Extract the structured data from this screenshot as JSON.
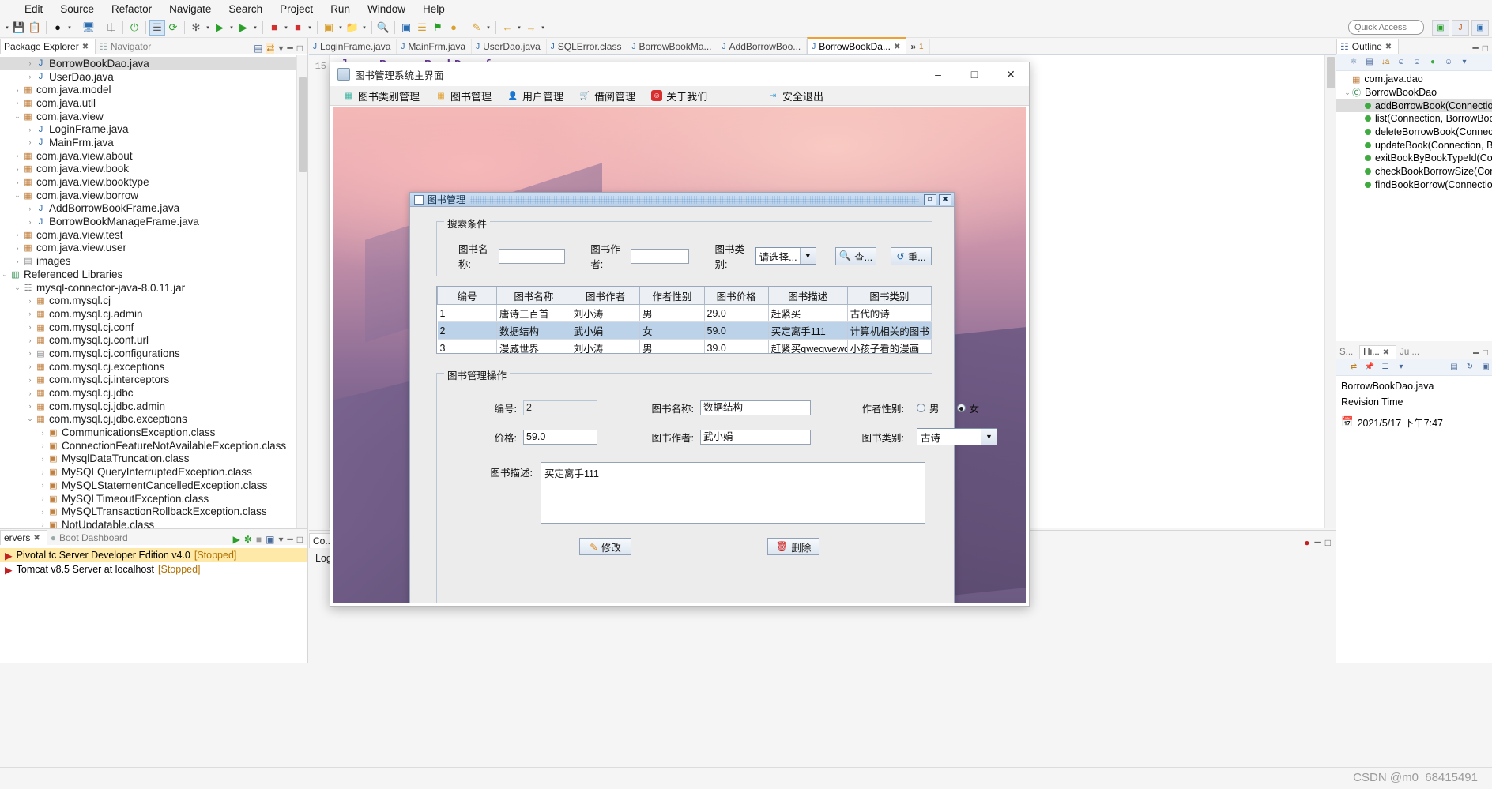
{
  "ide": {
    "menubar": [
      "Edit",
      "Source",
      "Refactor",
      "Navigate",
      "Search",
      "Project",
      "Run",
      "Window",
      "Help"
    ],
    "quick_access_placeholder": "Quick Access",
    "package_explorer": {
      "tab_label": "Package Explorer",
      "other_tab_label": "Navigator",
      "items": [
        {
          "label": "BorrowBookDao.java",
          "depth": 2,
          "arrow": "›",
          "icon": "java-file-icon",
          "selected": true
        },
        {
          "label": "UserDao.java",
          "depth": 2,
          "arrow": "›",
          "icon": "java-file-icon",
          "selected": false
        },
        {
          "label": "com.java.model",
          "depth": 1,
          "arrow": "›",
          "icon": "package-icon",
          "selected": false
        },
        {
          "label": "com.java.util",
          "depth": 1,
          "arrow": "›",
          "icon": "package-icon",
          "selected": false
        },
        {
          "label": "com.java.view",
          "depth": 1,
          "arrow": "⌄",
          "icon": "package-icon",
          "selected": false
        },
        {
          "label": "LoginFrame.java",
          "depth": 2,
          "arrow": "›",
          "icon": "java-file-icon",
          "selected": false
        },
        {
          "label": "MainFrm.java",
          "depth": 2,
          "arrow": "›",
          "icon": "java-file-icon",
          "selected": false
        },
        {
          "label": "com.java.view.about",
          "depth": 1,
          "arrow": "›",
          "icon": "package-icon",
          "selected": false
        },
        {
          "label": "com.java.view.book",
          "depth": 1,
          "arrow": "›",
          "icon": "package-warning-icon",
          "selected": false
        },
        {
          "label": "com.java.view.booktype",
          "depth": 1,
          "arrow": "›",
          "icon": "package-warning-icon",
          "selected": false
        },
        {
          "label": "com.java.view.borrow",
          "depth": 1,
          "arrow": "⌄",
          "icon": "package-warning-icon",
          "selected": false
        },
        {
          "label": "AddBorrowBookFrame.java",
          "depth": 2,
          "arrow": "›",
          "icon": "java-warning-file-icon",
          "selected": false
        },
        {
          "label": "BorrowBookManageFrame.java",
          "depth": 2,
          "arrow": "›",
          "icon": "java-warning-file-icon",
          "selected": false
        },
        {
          "label": "com.java.view.test",
          "depth": 1,
          "arrow": "›",
          "icon": "package-icon",
          "selected": false
        },
        {
          "label": "com.java.view.user",
          "depth": 1,
          "arrow": "›",
          "icon": "package-warning-icon",
          "selected": false
        },
        {
          "label": "images",
          "depth": 1,
          "arrow": "›",
          "icon": "folder-icon",
          "selected": false
        },
        {
          "label": "Referenced Libraries",
          "depth": 0,
          "arrow": "⌄",
          "icon": "library-icon",
          "selected": false
        },
        {
          "label": "mysql-connector-java-8.0.11.jar",
          "depth": 1,
          "arrow": "⌄",
          "icon": "jar-icon",
          "selected": false
        },
        {
          "label": "com.mysql.cj",
          "depth": 2,
          "arrow": "›",
          "icon": "package-icon",
          "selected": false
        },
        {
          "label": "com.mysql.cj.admin",
          "depth": 2,
          "arrow": "›",
          "icon": "package-icon",
          "selected": false
        },
        {
          "label": "com.mysql.cj.conf",
          "depth": 2,
          "arrow": "›",
          "icon": "package-icon",
          "selected": false
        },
        {
          "label": "com.mysql.cj.conf.url",
          "depth": 2,
          "arrow": "›",
          "icon": "package-icon",
          "selected": false
        },
        {
          "label": "com.mysql.cj.configurations",
          "depth": 2,
          "arrow": "›",
          "icon": "folder-icon",
          "selected": false
        },
        {
          "label": "com.mysql.cj.exceptions",
          "depth": 2,
          "arrow": "›",
          "icon": "package-icon",
          "selected": false
        },
        {
          "label": "com.mysql.cj.interceptors",
          "depth": 2,
          "arrow": "›",
          "icon": "package-icon",
          "selected": false
        },
        {
          "label": "com.mysql.cj.jdbc",
          "depth": 2,
          "arrow": "›",
          "icon": "package-icon",
          "selected": false
        },
        {
          "label": "com.mysql.cj.jdbc.admin",
          "depth": 2,
          "arrow": "›",
          "icon": "package-icon",
          "selected": false
        },
        {
          "label": "com.mysql.cj.jdbc.exceptions",
          "depth": 2,
          "arrow": "⌄",
          "icon": "package-icon",
          "selected": false
        },
        {
          "label": "CommunicationsException.class",
          "depth": 3,
          "arrow": "›",
          "icon": "class-icon",
          "selected": false
        },
        {
          "label": "ConnectionFeatureNotAvailableException.class",
          "depth": 3,
          "arrow": "›",
          "icon": "class-icon",
          "selected": false
        },
        {
          "label": "MysqlDataTruncation.class",
          "depth": 3,
          "arrow": "›",
          "icon": "class-icon",
          "selected": false
        },
        {
          "label": "MySQLQueryInterruptedException.class",
          "depth": 3,
          "arrow": "›",
          "icon": "class-icon",
          "selected": false
        },
        {
          "label": "MySQLStatementCancelledException.class",
          "depth": 3,
          "arrow": "›",
          "icon": "class-icon",
          "selected": false
        },
        {
          "label": "MySQLTimeoutException.class",
          "depth": 3,
          "arrow": "›",
          "icon": "class-icon",
          "selected": false
        },
        {
          "label": "MySQLTransactionRollbackException.class",
          "depth": 3,
          "arrow": "›",
          "icon": "class-icon",
          "selected": false
        },
        {
          "label": "NotUpdatable.class",
          "depth": 3,
          "arrow": "›",
          "icon": "class-icon",
          "selected": false
        }
      ]
    },
    "editor": {
      "tabs": [
        {
          "label": "LoginFrame.java",
          "active": false
        },
        {
          "label": "MainFrm.java",
          "active": false
        },
        {
          "label": "UserDao.java",
          "active": false
        },
        {
          "label": "SQLError.class",
          "active": false
        },
        {
          "label": "BorrowBookMa...",
          "active": false
        },
        {
          "label": "AddBorrowBoo...",
          "active": false
        },
        {
          "label": "BorrowBookDa...",
          "active": true
        }
      ],
      "overflow_label": "»",
      "overflow_count": "1",
      "line_number": "15",
      "code_line": "class BorrowBookDao {"
    },
    "console": {
      "tab_label": "Co...",
      "text": "Login"
    },
    "outline": {
      "tab_label": "Outline",
      "items": [
        {
          "label": "com.java.dao",
          "depth": 0,
          "icon": "package-icon",
          "arrow": "",
          "selected": false
        },
        {
          "label": "BorrowBookDao",
          "depth": 0,
          "icon": "class-icon",
          "arrow": "⌄",
          "selected": false
        },
        {
          "label": "addBorrowBook(Connectio",
          "depth": 1,
          "icon": "method-icon",
          "arrow": "",
          "selected": true
        },
        {
          "label": "list(Connection, BorrowBoo",
          "depth": 1,
          "icon": "method-icon",
          "arrow": "",
          "selected": false
        },
        {
          "label": "deleteBorrowBook(Connect",
          "depth": 1,
          "icon": "method-icon",
          "arrow": "",
          "selected": false
        },
        {
          "label": "updateBook(Connection, Bo",
          "depth": 1,
          "icon": "method-icon",
          "arrow": "",
          "selected": false
        },
        {
          "label": "exitBookByBookTypeId(Cor",
          "depth": 1,
          "icon": "method-icon",
          "arrow": "",
          "selected": false
        },
        {
          "label": "checkBookBorrowSize(Conr",
          "depth": 1,
          "icon": "method-icon",
          "arrow": "",
          "selected": false
        },
        {
          "label": "findBookBorrow(Connectio",
          "depth": 1,
          "icon": "method-icon",
          "arrow": "",
          "selected": false
        }
      ]
    },
    "history_panel": {
      "tabs": [
        "S...",
        "Hi...",
        "Ju ..."
      ],
      "file_name": "BorrowBookDao.java",
      "column_header": "Revision Time",
      "revision": "2021/5/17 下午7:47"
    },
    "servers": {
      "tab_label": "ervers",
      "other_tab_label": "Boot Dashboard",
      "rows": [
        {
          "name": "Pivotal tc Server Developer Edition v4.0",
          "status": "[Stopped]",
          "selected": true
        },
        {
          "name": "Tomcat v8.5 Server at localhost",
          "status": "[Stopped]",
          "selected": false
        }
      ]
    },
    "watermark": "CSDN @m0_68415491"
  },
  "app": {
    "title": "图书管理系统主界面",
    "window_buttons": {
      "minimize": "–",
      "maximize": "□",
      "close": "✕"
    },
    "menu": [
      {
        "label": "图书类别管理",
        "icon": "grid-icon",
        "color": "#3bb3a0"
      },
      {
        "label": "图书管理",
        "icon": "books-icon",
        "color": "#e0a030"
      },
      {
        "label": "用户管理",
        "icon": "user-icon",
        "color": "#5a8fd0"
      },
      {
        "label": "借阅管理",
        "icon": "cart-icon",
        "color": "#4a9ad0"
      },
      {
        "label": "关于我们",
        "icon": "smiley-icon",
        "color": "#d83030"
      }
    ],
    "exit": {
      "label": "安全退出",
      "icon": "logout-icon"
    }
  },
  "book_frame": {
    "title": "图书管理",
    "restore_icon": "restore-icon",
    "close_icon": "close-icon",
    "search": {
      "legend": "搜索条件",
      "name_label": "图书名称:",
      "name_value": "",
      "author_label": "图书作者:",
      "author_value": "",
      "category_label": "图书类别:",
      "category_value": "请选择...",
      "search_button": "查...",
      "reset_button": "重...",
      "search_icon": "magnifier-icon",
      "reset_icon": "refresh-icon"
    },
    "table": {
      "columns": [
        "编号",
        "图书名称",
        "图书作者",
        "作者性别",
        "图书价格",
        "图书描述",
        "图书类别"
      ],
      "rows": [
        {
          "cells": [
            "1",
            "唐诗三百首",
            "刘小涛",
            "男",
            "29.0",
            "赶紧买",
            "古代的诗"
          ],
          "selected": false
        },
        {
          "cells": [
            "2",
            "数据结构",
            "武小娟",
            "女",
            "59.0",
            "买定离手111",
            "计算机相关的图书"
          ],
          "selected": true
        },
        {
          "cells": [
            "3",
            "漫威世界",
            "刘小涛",
            "男",
            "39.0",
            "赶紧买qweqwewq",
            "小孩子看的漫画"
          ],
          "selected": false
        }
      ]
    },
    "operations": {
      "legend": "图书管理操作",
      "id_label": "编号:",
      "id_value": "2",
      "name_label": "图书名称:",
      "name_value": "数据结构",
      "gender_label": "作者性别:",
      "gender_male": "男",
      "gender_female": "女",
      "gender_selected": "女",
      "price_label": "价格:",
      "price_value": "59.0",
      "author_label": "图书作者:",
      "author_value": "武小娟",
      "category_label": "图书类别:",
      "category_value": "古诗",
      "desc_label": "图书描述:",
      "desc_value": "买定离手111",
      "update_button": "修改",
      "delete_button": "删除",
      "update_icon": "edit-icon",
      "delete_icon": "trash-icon"
    }
  }
}
